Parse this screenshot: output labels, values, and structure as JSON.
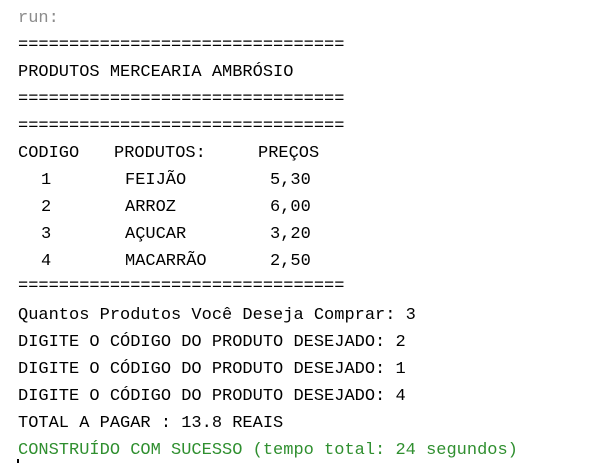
{
  "console": {
    "run_label": "run:",
    "separator": "================================",
    "title": "PRODUTOS MERCEARIA AMBRÓSIO",
    "table": {
      "headers": [
        "CODIGO",
        "PRODUTOS:",
        "PREÇOS"
      ],
      "rows": [
        {
          "code": "1",
          "product": "FEIJÃO",
          "price": "5,30"
        },
        {
          "code": "2",
          "product": "ARROZ",
          "price": "6,00"
        },
        {
          "code": "3",
          "product": "AÇUCAR",
          "price": "3,20"
        },
        {
          "code": "4",
          "product": "MACARRÃO",
          "price": "2,50"
        }
      ]
    },
    "prompt_quantity": "Quantos Produtos Você Deseja Comprar: 3",
    "entries": [
      "DIGITE O CÓDIGO DO PRODUTO DESEJADO: 2",
      "DIGITE O CÓDIGO DO PRODUTO DESEJADO: 1",
      "DIGITE O CÓDIGO DO PRODUTO DESEJADO: 4"
    ],
    "total": "TOTAL A PAGAR : 13.8 REAIS",
    "build_status": "CONSTRUÍDO COM SUCESSO (tempo total: 24 segundos)"
  }
}
